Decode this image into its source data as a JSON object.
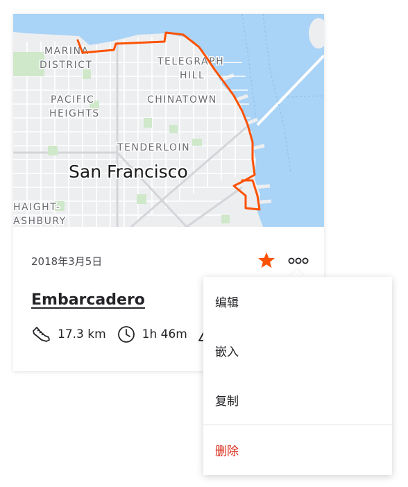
{
  "map": {
    "city_label": "San Francisco",
    "neighborhood_labels": [
      "MARINA",
      "DISTRICT",
      "TELEGRAPH",
      "HILL",
      "PACIFIC",
      "HEIGHTS",
      "CHINATOWN",
      "TENDERLOIN",
      "HAIGHT-",
      "ASHBURY"
    ],
    "route_color": "#fc5200",
    "water_color": "#a9d3f7",
    "park_color": "#cfe8c9"
  },
  "activity": {
    "date": "2018年3月5日",
    "name": "Embarcadero",
    "distance": "17.3 km",
    "moving_time": "1h 46m",
    "starred": true,
    "star_color": "#fc5200",
    "distance_icon": "shoe-icon",
    "time_icon": "clock-icon",
    "elevation_icon": "elevation-icon"
  },
  "menu": {
    "items": [
      {
        "label": "编辑",
        "color": "#242428"
      },
      {
        "label": "嵌入",
        "color": "#242428"
      },
      {
        "label": "复制",
        "color": "#242428"
      },
      {
        "label": "删除",
        "color": "#d92b1a"
      }
    ]
  }
}
